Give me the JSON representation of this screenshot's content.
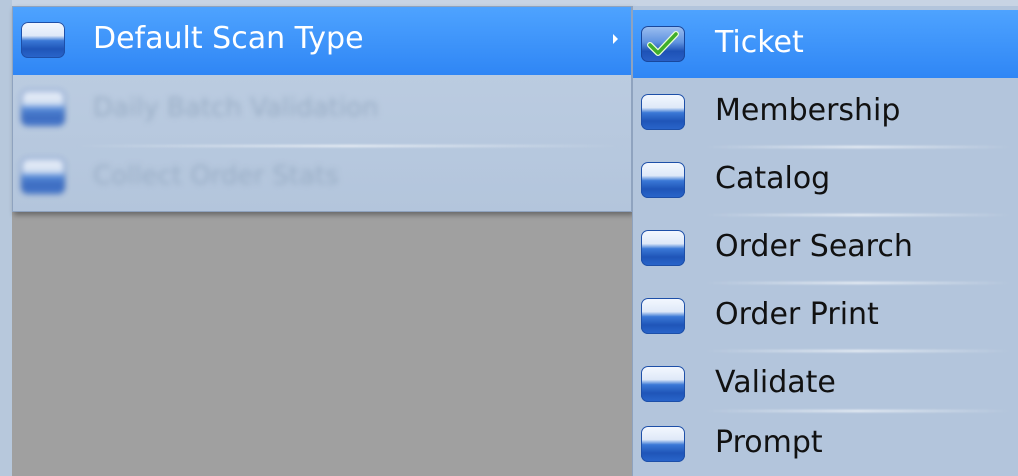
{
  "menu": {
    "items": [
      {
        "label": "Default Scan Type",
        "icon": "gem-icon",
        "state": "highlighted",
        "has_submenu": true
      },
      {
        "label": "Daily Batch Validation",
        "icon": "gem-icon",
        "state": "disabled",
        "has_submenu": false
      },
      {
        "label": "Collect Order Stats",
        "icon": "gem-icon",
        "state": "disabled",
        "has_submenu": false
      }
    ]
  },
  "submenu": {
    "items": [
      {
        "label": "Ticket",
        "icon": "check-icon",
        "checked": true,
        "state": "highlighted"
      },
      {
        "label": "Membership",
        "icon": "gem-icon",
        "checked": false
      },
      {
        "label": "Catalog",
        "icon": "gem-icon",
        "checked": false
      },
      {
        "label": "Order Search",
        "icon": "gem-icon",
        "checked": false
      },
      {
        "label": "Order Print",
        "icon": "gem-icon",
        "checked": false
      },
      {
        "label": "Validate",
        "icon": "gem-icon",
        "checked": false
      },
      {
        "label": "Prompt",
        "icon": "gem-icon",
        "checked": false
      }
    ]
  },
  "colors": {
    "highlight": "#2f86f5",
    "menu_background": "#b3c5dc",
    "backdrop": "#a0a0a0",
    "check_green": "#3fae2a"
  }
}
